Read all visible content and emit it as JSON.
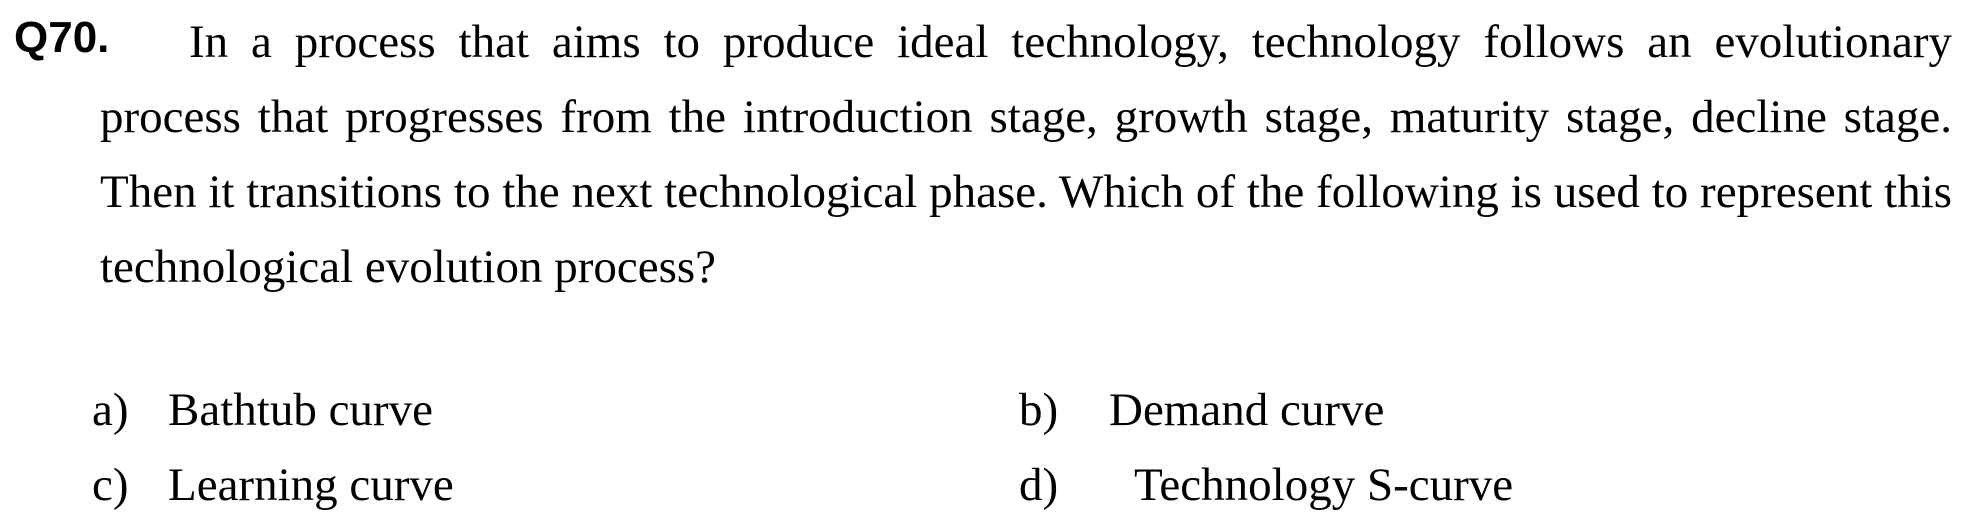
{
  "question": {
    "number": "Q70.",
    "text": "In a process that aims to produce ideal technology, technology follows an evolutionary process that progresses from the introduction stage, growth stage, maturity stage, decline stage. Then it transitions to the next technological phase. Which of the following is used to represent this technological evolution process?"
  },
  "options": [
    {
      "letter": "a)",
      "label": "Bathtub curve"
    },
    {
      "letter": "b)",
      "label": "Demand curve"
    },
    {
      "letter": "c)",
      "label": "Learning curve"
    },
    {
      "letter": "d)",
      "label": "Technology S-curve"
    }
  ]
}
